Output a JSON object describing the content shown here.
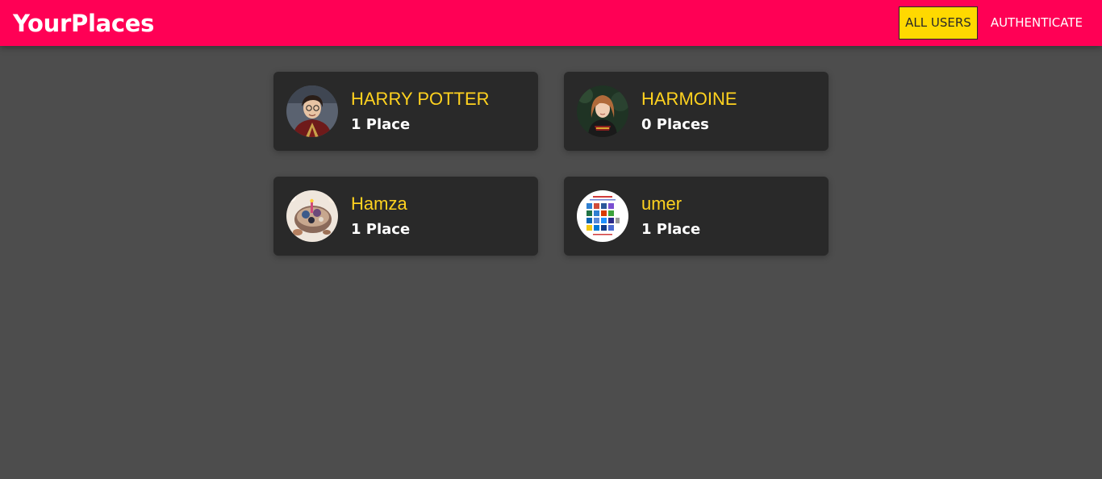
{
  "header": {
    "brand": "YourPlaces",
    "nav": [
      {
        "label": "ALL USERS",
        "active": true
      },
      {
        "label": "AUTHENTICATE",
        "active": false
      }
    ]
  },
  "colors": {
    "header_bg": "#ff0055",
    "page_bg": "#4d4d4d",
    "card_bg": "#292929",
    "name": "#ffd21f",
    "active_nav": "#ffd900"
  },
  "users": [
    {
      "name": "HARRY POTTER",
      "places": "1 Place",
      "avatar_icon": "boy-portrait-avatar"
    },
    {
      "name": "HARMOINE",
      "places": "0 Places",
      "avatar_icon": "girl-portrait-avatar"
    },
    {
      "name": "Hamza",
      "places": "1 Place",
      "avatar_icon": "cake-photo-avatar"
    },
    {
      "name": "umer",
      "places": "1 Place",
      "avatar_icon": "app-icons-grid-avatar"
    }
  ]
}
